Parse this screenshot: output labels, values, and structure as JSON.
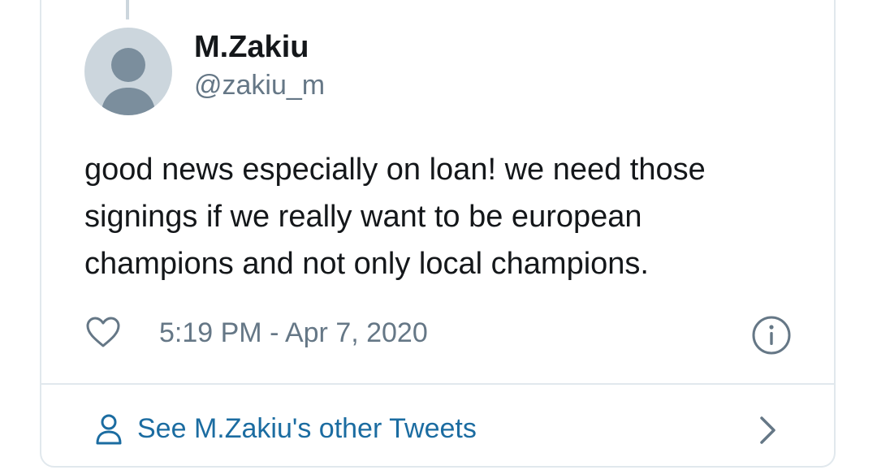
{
  "tweet": {
    "display_name": "M.Zakiu",
    "handle": "@zakiu_m",
    "text": "good news especially on loan! we need those signings if we really want to be european champions and not only local champions.",
    "timestamp": "5:19 PM - Apr 7, 2020"
  },
  "icons": {
    "avatar": "default-avatar-icon",
    "like": "heart-icon",
    "info": "info-icon",
    "profile": "person-icon",
    "chevron": "chevron-right-icon"
  },
  "footer": {
    "link_label": "See M.Zakiu's other Tweets"
  },
  "colors": {
    "link": "#1b6ca1",
    "secondary_text": "#657786",
    "primary_text": "#14171a",
    "border": "#e1e8ed",
    "avatar_bg": "#ccd6dd",
    "avatar_fg": "#7b8e9d"
  }
}
